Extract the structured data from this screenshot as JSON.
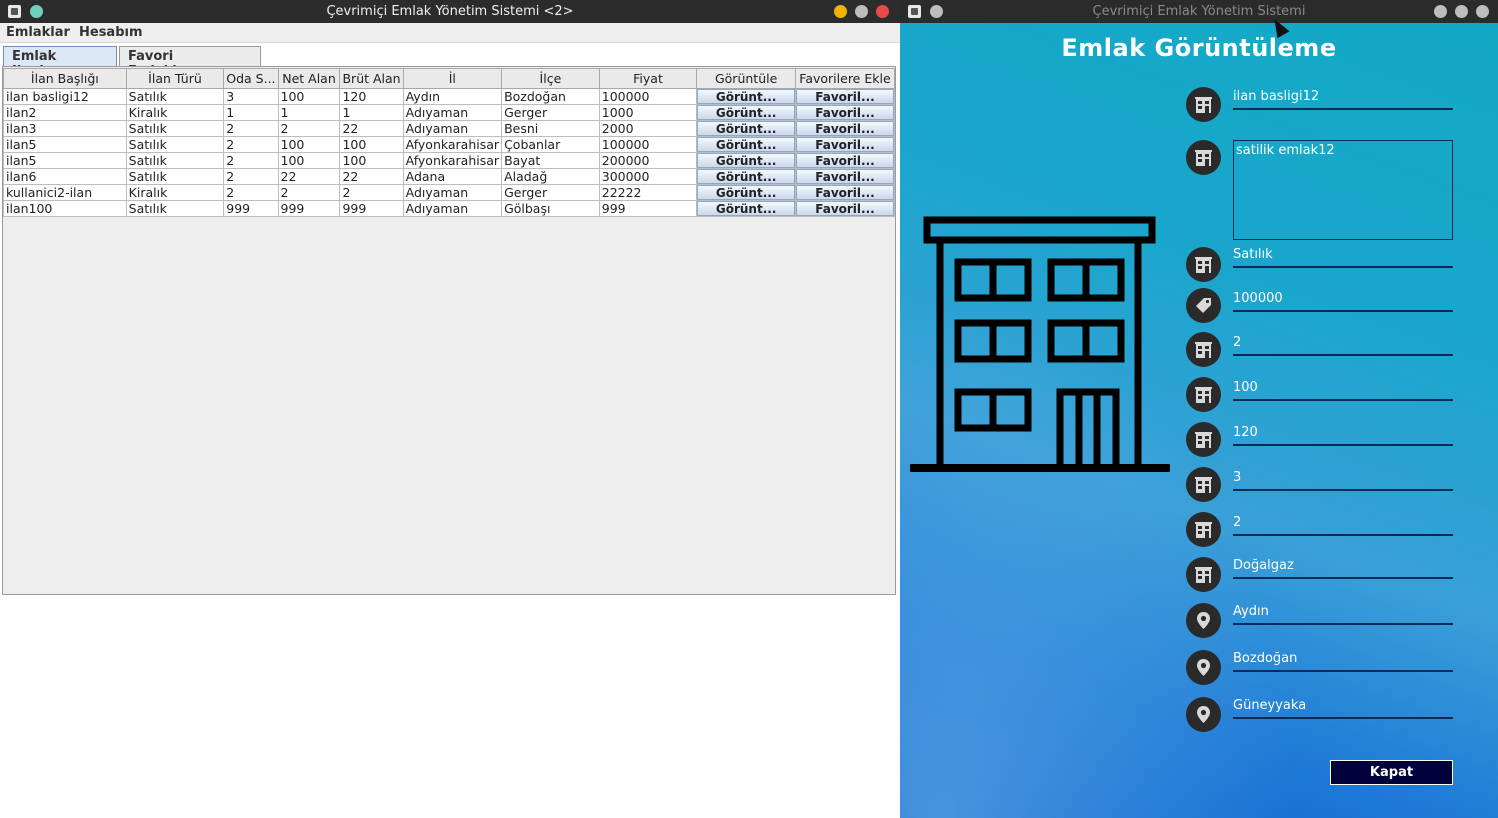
{
  "left_window": {
    "title": "Çevrimiçi Emlak Yönetim Sistemi <2>",
    "dot_colors": [
      "#f0b400",
      "#bdbdbd",
      "#e84a4a"
    ],
    "menu": [
      "Emlaklar",
      "Hesabım"
    ],
    "tabs": [
      "Emlak Ilanları",
      "Favori Emlaklarım"
    ],
    "table": {
      "columns": [
        "İlan Başlığı",
        "İlan Türü",
        "Oda S...",
        "Net Alan",
        "Brüt Alan",
        "İl",
        "İlçe",
        "Fiyat",
        "Görüntüle",
        "Favorilere Ekle"
      ],
      "rows": [
        [
          "ilan basligi12",
          "Satılık",
          "3",
          "100",
          "120",
          "Aydın",
          "Bozdoğan",
          "100000",
          "Görünt...",
          "Favoril..."
        ],
        [
          "ilan2",
          "Kiralık",
          "1",
          "1",
          "1",
          "Adıyaman",
          "Gerger",
          "1000",
          "Görünt...",
          "Favoril..."
        ],
        [
          "ilan3",
          "Satılık",
          "2",
          "2",
          "22",
          "Adıyaman",
          "Besni",
          "2000",
          "Görünt...",
          "Favoril..."
        ],
        [
          "ilan5",
          "Satılık",
          "2",
          "100",
          "100",
          "Afyonkarahisar",
          "Çobanlar",
          "100000",
          "Görünt...",
          "Favoril..."
        ],
        [
          "ilan5",
          "Satılık",
          "2",
          "100",
          "100",
          "Afyonkarahisar",
          "Bayat",
          "200000",
          "Görünt...",
          "Favoril..."
        ],
        [
          "ilan6",
          "Satılık",
          "2",
          "22",
          "22",
          "Adana",
          "Aladağ",
          "300000",
          "Görünt...",
          "Favoril..."
        ],
        [
          "kullanici2-ilan",
          "Kiralık",
          "2",
          "2",
          "2",
          "Adıyaman",
          "Gerger",
          "22222",
          "Görünt...",
          "Favoril..."
        ],
        [
          "ilan100",
          "Satılık",
          "999",
          "999",
          "999",
          "Adıyaman",
          "Gölbaşı",
          "999",
          "Görünt...",
          "Favoril..."
        ]
      ]
    }
  },
  "right_window": {
    "title": "Çevrimiçi Emlak Yönetim Sistemi",
    "heading": "Emlak Görüntüleme",
    "fields": [
      {
        "icon": "building-icon",
        "value": "ilan basligi12"
      },
      {
        "icon": "building-icon",
        "value": "satilik emlak12"
      },
      {
        "icon": "building-icon",
        "value": "Satılık"
      },
      {
        "icon": "price-tag-icon",
        "value": "100000"
      },
      {
        "icon": "building-icon",
        "value": "2"
      },
      {
        "icon": "building-icon",
        "value": "100"
      },
      {
        "icon": "building-icon",
        "value": "120"
      },
      {
        "icon": "building-icon",
        "value": "3"
      },
      {
        "icon": "building-icon",
        "value": "2"
      },
      {
        "icon": "building-icon",
        "value": "Doğalgaz"
      },
      {
        "icon": "location-pin-icon",
        "value": "Aydın"
      },
      {
        "icon": "location-pin-icon",
        "value": "Bozdoğan"
      },
      {
        "icon": "location-pin-icon",
        "value": "Güneyyaka"
      }
    ],
    "close_button": "Kapat"
  }
}
